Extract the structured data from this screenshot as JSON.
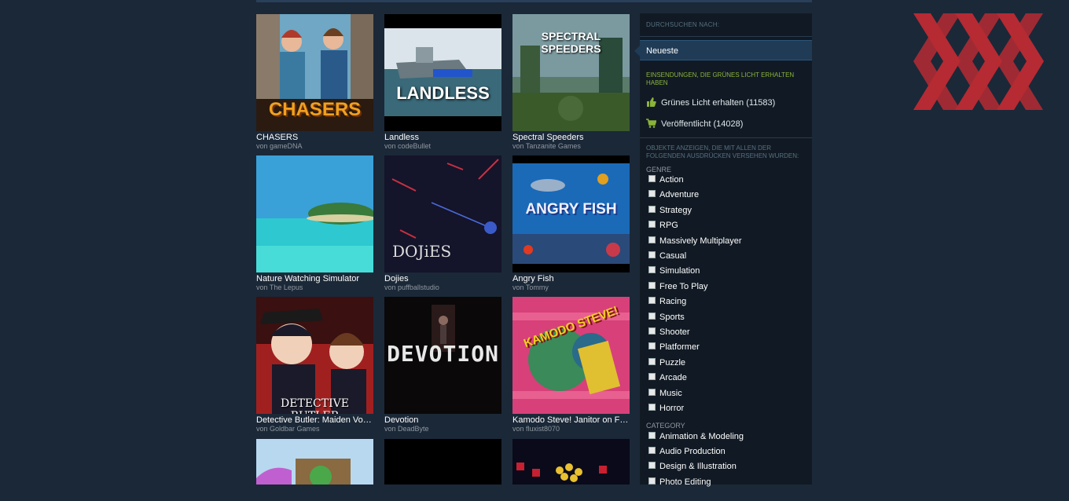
{
  "games": [
    {
      "title": "CHASERS",
      "author": "von gameDNA",
      "thumb_text": "CHASERS"
    },
    {
      "title": "Landless",
      "author": "von codeBullet",
      "thumb_text": "LANDLESS"
    },
    {
      "title": "Spectral Speeders",
      "author": "von Tanzanite Games",
      "thumb_text": "SPECTRAL SPEEDERS"
    },
    {
      "title": "Nature Watching Simulator",
      "author": "von The Lepus",
      "thumb_text": ""
    },
    {
      "title": "Dojies",
      "author": "von puffballstudio",
      "thumb_text": "DOJiES"
    },
    {
      "title": "Angry Fish",
      "author": "von Tommy",
      "thumb_text": "ANGRY FISH"
    },
    {
      "title": "Detective Butler: Maiden Voy…",
      "author": "von Goldbar Games",
      "thumb_text": "DETECTIVE BUTLER"
    },
    {
      "title": "Devotion",
      "author": "von DeadByte",
      "thumb_text": "DEVOTION"
    },
    {
      "title": "Kamodo Steve! Janitor on Fire!",
      "author": "von fluxist8070",
      "thumb_text": "KAMODO STEVE!"
    }
  ],
  "panel": {
    "browse_label": "DURCHSUCHEN NACH:",
    "selected": "Neueste",
    "greenlight_header": "EINSENDUNGEN, DIE GRÜNES LICHT ERHALTEN HABEN",
    "greenlit": "Grünes Licht erhalten (11583)",
    "released": "Veröffentlicht (14028)",
    "filter_header": "OBJEKTE ANZEIGEN, DIE MIT ALLEN DER FOLGENDEN AUSDRÜCKEN VERSEHEN WURDEN:",
    "genre_label": "GENRE",
    "genres": [
      "Action",
      "Adventure",
      "Strategy",
      "RPG",
      "Massively Multiplayer",
      "Casual",
      "Simulation",
      "Free To Play",
      "Racing",
      "Sports",
      "Shooter",
      "Platformer",
      "Puzzle",
      "Arcade",
      "Music",
      "Horror"
    ],
    "category_label": "CATEGORY",
    "categories": [
      "Animation & Modeling",
      "Audio Production",
      "Design & Illustration",
      "Photo Editing"
    ]
  },
  "colors": {
    "background": "#1b2838",
    "panel": "#111a24",
    "selected": "#1f3b56",
    "green": "#8bb33a",
    "logo_red": "#c42b33"
  },
  "icons": {
    "greenlit": "thumbs-up-icon",
    "released": "cart-icon"
  }
}
